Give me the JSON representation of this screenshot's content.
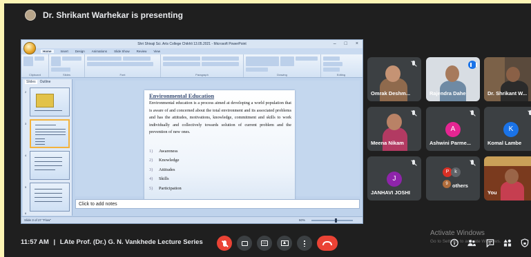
{
  "meeting": {
    "presenting_text": "Dr. Shrikant Warhekar is presenting",
    "time": "11:57 AM",
    "separator": "|",
    "title": "LAte Prof. (Dr.) G. N. Vankhede Lecture Series"
  },
  "ppt": {
    "window_title": "Shri Shivaji Sci. Arts College Chikhli 13.05.2021 - Microsoft PowerPoint",
    "tabs": [
      "Home",
      "Insert",
      "Design",
      "Animations",
      "Slide Show",
      "Review",
      "View"
    ],
    "ribbon_groups": [
      "Clipboard",
      "Slides",
      "Font",
      "Paragraph",
      "Drawing",
      "Editing"
    ],
    "panel_tabs": [
      "Slides",
      "Outline"
    ],
    "thumb_numbers": [
      "2",
      "3",
      "4",
      "5",
      "6"
    ],
    "notes_placeholder": "Click to add notes",
    "status_left": "Slide 3 of 27   \"Flow\"",
    "zoom": "60%",
    "zoom_level": 0.6
  },
  "slide": {
    "title": "Environmental Education",
    "paragraph": "Environmental education is a process aimed at developing a world population that is aware of and concerned about the total environment and its associated problems and has the attitudes, motivations, knowledge, commitment and skills to work individually and collectively towards solution of current problem and the prevention of new ones.",
    "list": [
      {
        "num": "1)",
        "text": "Awareness"
      },
      {
        "num": "2)",
        "text": "Knowledge"
      },
      {
        "num": "3)",
        "text": "Attitudes"
      },
      {
        "num": "4)",
        "text": "Skills"
      },
      {
        "num": "5)",
        "text": "Participation"
      }
    ]
  },
  "participants": [
    {
      "name": "Omrak Deshm...",
      "type": "video"
    },
    {
      "name": "Rajendra Dahe",
      "type": "video"
    },
    {
      "name": "Dr. Shrikant W...",
      "type": "video"
    },
    {
      "name": "Meena Nikam",
      "type": "video"
    },
    {
      "name": "Ashwini Parme...",
      "type": "avatar",
      "letter": "A",
      "color": "#e52592"
    },
    {
      "name": "Komal Lambe",
      "type": "avatar",
      "letter": "K",
      "color": "#1a73e8"
    },
    {
      "name": "JANHAVI JOSHI",
      "type": "avatar",
      "letter": "J",
      "color": "#8e24aa"
    },
    {
      "name": "others",
      "type": "group",
      "count_label": "9",
      "letter_p": "P",
      "letter_k": "k"
    },
    {
      "name": "You",
      "type": "video"
    }
  ],
  "watermark": {
    "title": "Activate Windows",
    "sub": "Go to Settings to activate Windows."
  },
  "controls": {
    "cc_label": "CC"
  },
  "colors": {
    "meet_bg": "#1f1f1f",
    "tile_bg": "#3c4043",
    "end_call": "#ea4335",
    "outer_bg": "#fdf5b5"
  }
}
